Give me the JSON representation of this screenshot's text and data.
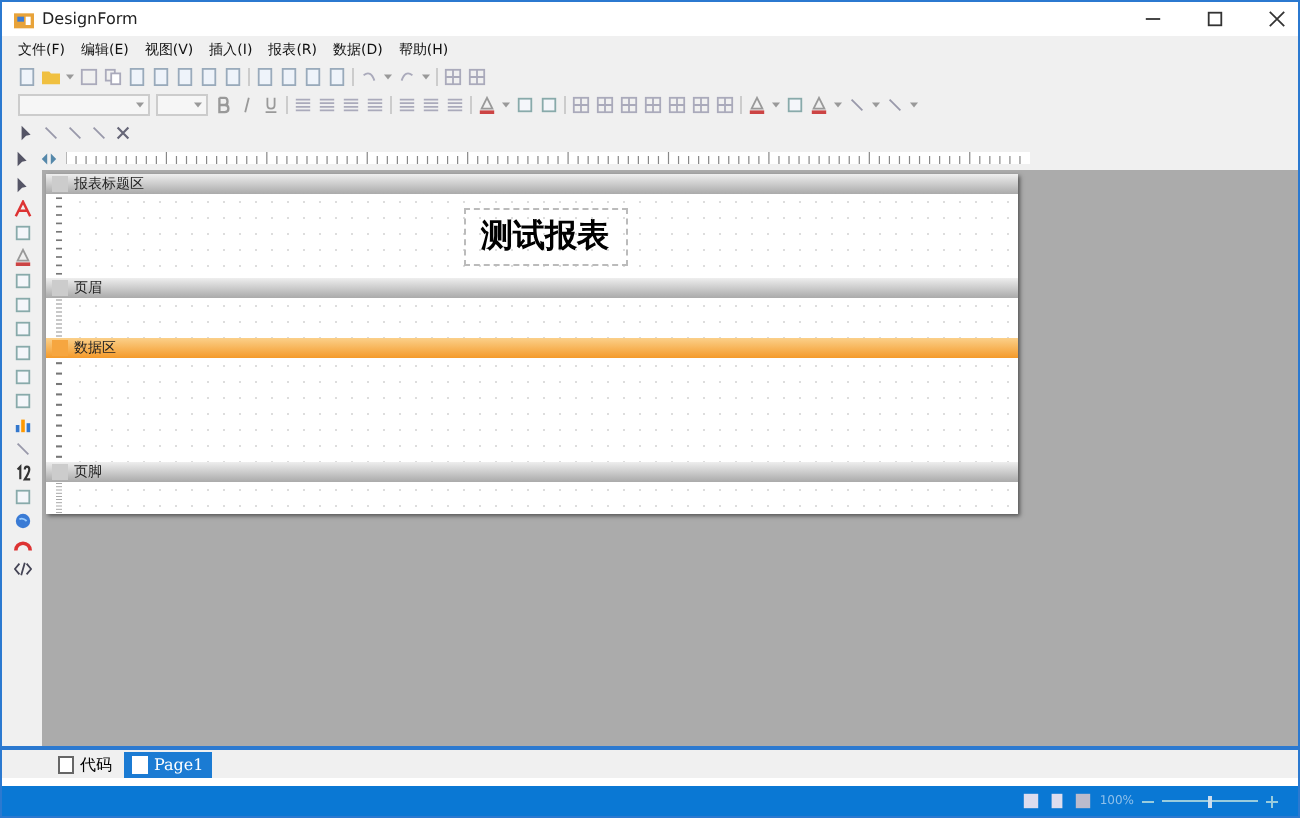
{
  "window": {
    "title": "DesignForm"
  },
  "menu": [
    {
      "label": "文件(F)"
    },
    {
      "label": "编辑(E)"
    },
    {
      "label": "视图(V)"
    },
    {
      "label": "插入(I)"
    },
    {
      "label": "报表(R)"
    },
    {
      "label": "数据(D)"
    },
    {
      "label": "帮助(H)"
    }
  ],
  "report": {
    "bands": [
      {
        "name": "报表标题区",
        "selected": false,
        "kind": "title",
        "text": "测试报表"
      },
      {
        "name": "页眉",
        "selected": false,
        "kind": "header"
      },
      {
        "name": "数据区",
        "selected": true,
        "kind": "data"
      },
      {
        "name": "页脚",
        "selected": false,
        "kind": "footer"
      }
    ]
  },
  "bottom_tabs": [
    {
      "label": "代码",
      "selected": false
    },
    {
      "label": "Page1",
      "selected": true
    }
  ],
  "status_bar": {
    "zoom": "100%",
    "zoom_slider": {
      "level": 0.5
    }
  }
}
